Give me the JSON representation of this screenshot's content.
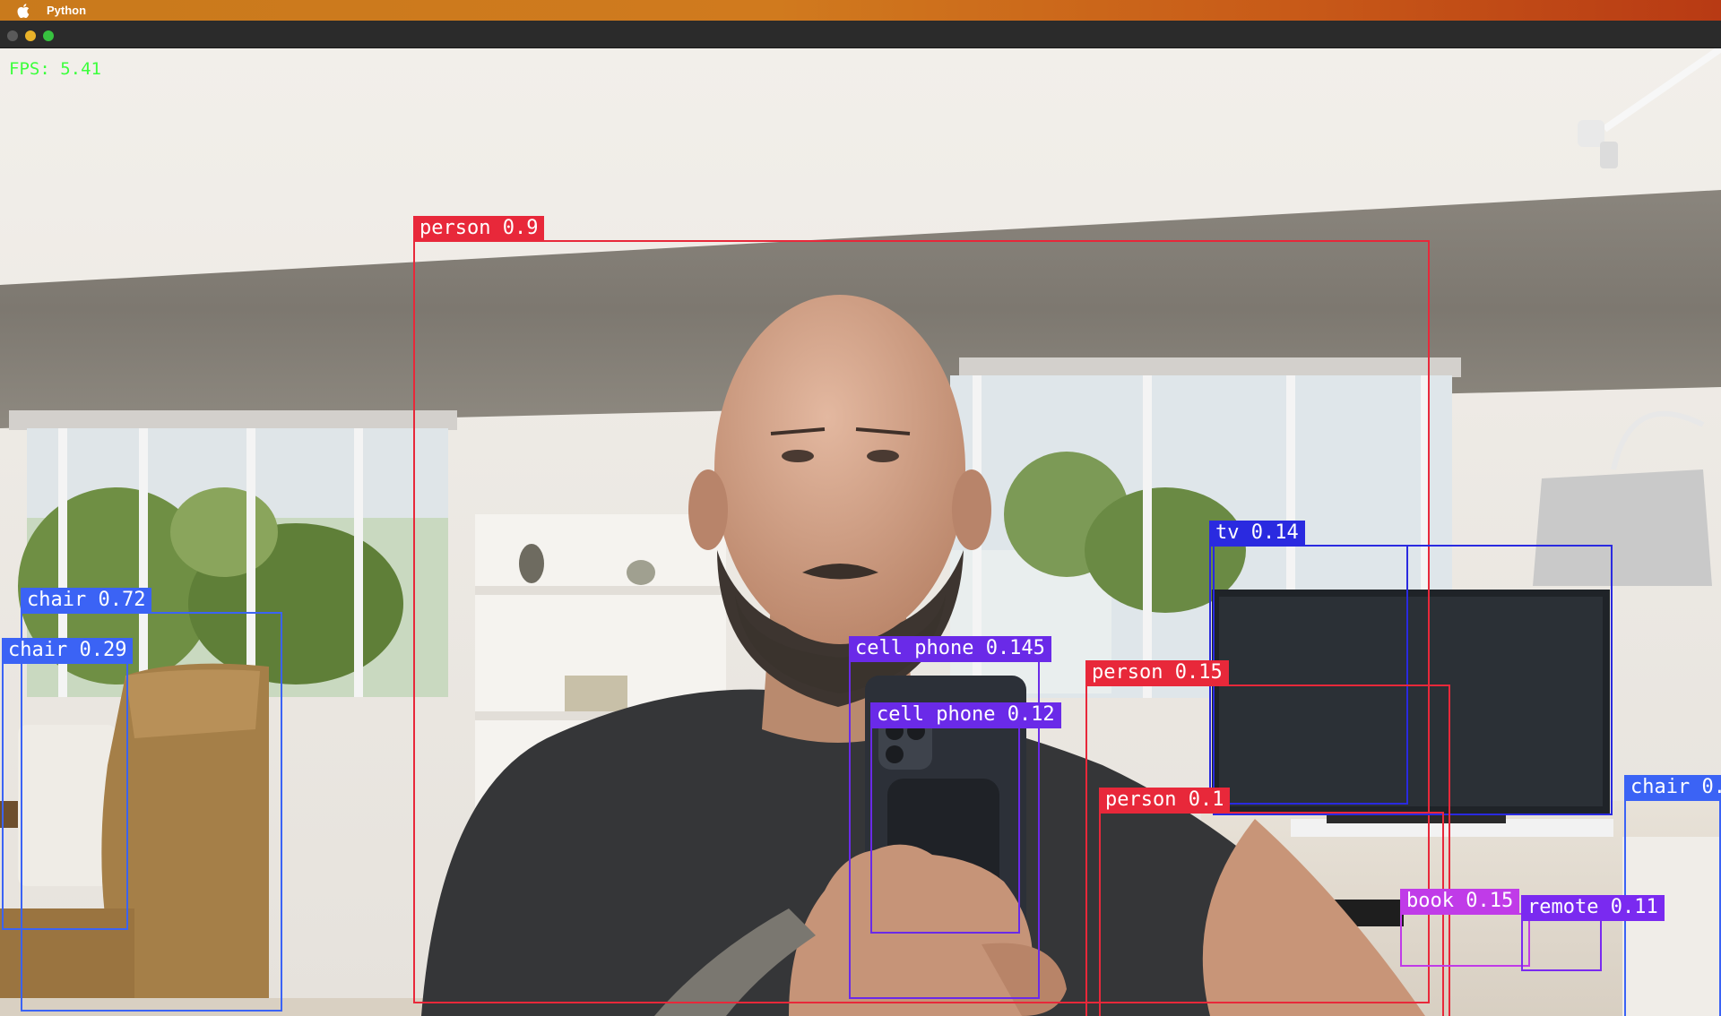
{
  "menubar": {
    "app_name": "Python",
    "apple_icon": "apple-logo-icon"
  },
  "window": {
    "traffic_lights": [
      "close-button",
      "minimize-button",
      "zoom-button"
    ]
  },
  "overlay": {
    "fps_text": "FPS: 5.41",
    "fps_color": "#3cff3c"
  },
  "colors": {
    "person": "#e8283a",
    "chair": "#3b63f5",
    "tv": "#2a2ae0",
    "cell_phone": "#6a2ae8",
    "book": "#c03be8",
    "remote": "#7a2af0"
  },
  "detections": [
    {
      "label": "person 0.9",
      "cls": "person"
    },
    {
      "label": "chair 0.72",
      "cls": "chair"
    },
    {
      "label": "chair 0.29",
      "cls": "chair"
    },
    {
      "label": "tv 0.14",
      "cls": "tv"
    },
    {
      "label": "tv 0.14",
      "cls": "tv"
    },
    {
      "label": "cell phone 0.145",
      "cls": "cell_phone"
    },
    {
      "label": "cell phone 0.12",
      "cls": "cell_phone"
    },
    {
      "label": "person 0.15",
      "cls": "person"
    },
    {
      "label": "person 0.1",
      "cls": "person"
    },
    {
      "label": "chair 0.",
      "cls": "chair"
    },
    {
      "label": "book 0.15",
      "cls": "book"
    },
    {
      "label": "remote 0.11",
      "cls": "remote"
    }
  ]
}
